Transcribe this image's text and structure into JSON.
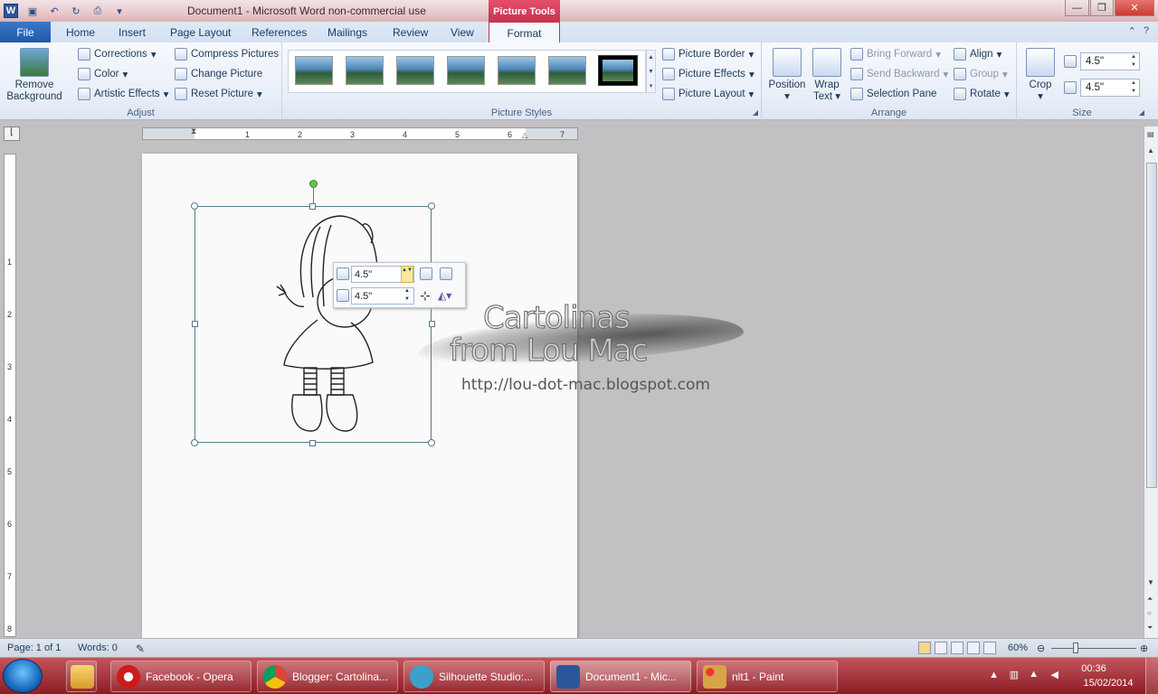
{
  "titlebar": {
    "title": "Document1  -  Microsoft Word non-commercial use",
    "contextual_tab": "Picture Tools",
    "buttons": {
      "minimize": "—",
      "restore": "❐",
      "close": "✕"
    }
  },
  "tabs": {
    "file": "File",
    "home": "Home",
    "insert": "Insert",
    "page_layout": "Page Layout",
    "references": "References",
    "mailings": "Mailings",
    "review": "Review",
    "view": "View",
    "format": "Format"
  },
  "ribbon": {
    "adjust": {
      "label": "Adjust",
      "remove_background": "Remove Background",
      "corrections": "Corrections",
      "color": "Color",
      "artistic_effects": "Artistic Effects",
      "compress_pictures": "Compress Pictures",
      "change_picture": "Change Picture",
      "reset_picture": "Reset Picture"
    },
    "picture_styles": {
      "label": "Picture Styles",
      "picture_border": "Picture Border",
      "picture_effects": "Picture Effects",
      "picture_layout": "Picture Layout"
    },
    "arrange": {
      "label": "Arrange",
      "position": "Position",
      "wrap_text": "Wrap Text",
      "bring_forward": "Bring Forward",
      "send_backward": "Send Backward",
      "selection_pane": "Selection Pane",
      "align": "Align",
      "group": "Group",
      "rotate": "Rotate"
    },
    "size": {
      "label": "Size",
      "crop": "Crop",
      "height": "4.5\"",
      "width": "4.5\""
    }
  },
  "ruler": {
    "ticks": [
      "1",
      "2",
      "3",
      "4",
      "5",
      "6",
      "7"
    ],
    "vticks": [
      "1",
      "2",
      "3",
      "4",
      "5",
      "6",
      "7",
      "8"
    ]
  },
  "mini_toolbar": {
    "height": "4.5\"",
    "width": "4.5\""
  },
  "watermark": {
    "line1": "Cartolinas",
    "line2": "from Lou Mac",
    "url": "http://lou-dot-mac.blogspot.com"
  },
  "statusbar": {
    "page": "Page: 1 of 1",
    "words": "Words: 0",
    "zoom": "60%"
  },
  "taskbar": {
    "items": [
      {
        "label": "Facebook - Opera",
        "color": "#cc1b1b"
      },
      {
        "label": "Blogger: Cartolina...",
        "color": "#3a8d3e"
      },
      {
        "label": "Silhouette Studio:...",
        "color": "#3ba1c9"
      },
      {
        "label": "Document1 - Mic...",
        "color": "#2b579a"
      },
      {
        "label": "nlt1 - Paint",
        "color": "#d9a34a"
      }
    ],
    "time": "00:36",
    "date": "15/02/2014"
  }
}
